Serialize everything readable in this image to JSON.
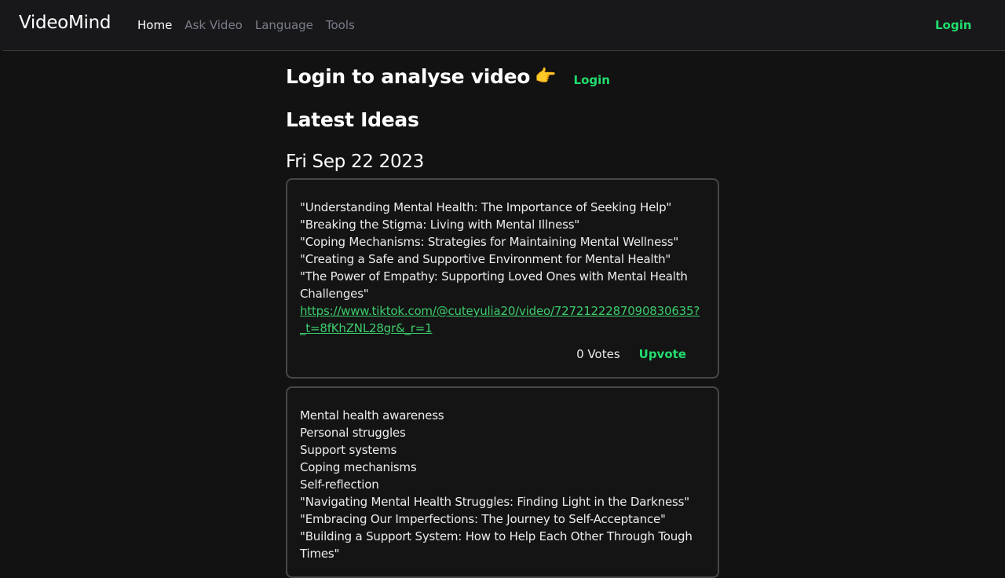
{
  "nav": {
    "brand": "VideoMind",
    "links": [
      {
        "label": "Home",
        "active": true
      },
      {
        "label": "Ask Video",
        "active": false
      },
      {
        "label": "Language",
        "active": false
      },
      {
        "label": "Tools",
        "active": false
      }
    ],
    "login_label": "Login"
  },
  "colors": {
    "accent": "#22dd6e",
    "link": "#3ccc6c",
    "background": "#121212",
    "navbar": "#18181b"
  },
  "hero": {
    "title": "Login to analyse video",
    "icon": "👉",
    "login_label": "Login"
  },
  "ideas": {
    "title": "Latest Ideas",
    "date": "Fri Sep 22 2023",
    "cards": [
      {
        "lines": [
          "\"Understanding Mental Health: The Importance of Seeking Help\"",
          "\"Breaking the Stigma: Living with Mental Illness\"",
          "\"Coping Mechanisms: Strategies for Maintaining Mental Wellness\"",
          "\"Creating a Safe and Supportive Environment for Mental Health\"",
          "\"The Power of Empathy: Supporting Loved Ones with Mental Health Challenges\""
        ],
        "url": "https://www.tiktok.com/@cuteyulia20/video/7272122287090830635?_t=8fKhZNL28gr&_r=1",
        "votes": "0 Votes",
        "upvote_label": "Upvote"
      },
      {
        "lines": [
          "Mental health awareness",
          "Personal struggles",
          "Support systems",
          "Coping mechanisms",
          "Self-reflection",
          "\"Navigating Mental Health Struggles: Finding Light in the Darkness\"",
          "\"Embracing Our Imperfections: The Journey to Self-Acceptance\"",
          "\"Building a Support System: How to Help Each Other Through Tough Times\""
        ]
      }
    ]
  }
}
